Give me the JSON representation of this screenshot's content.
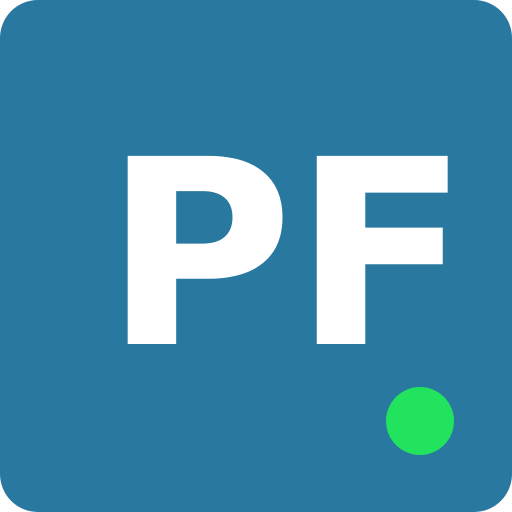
{
  "logo": {
    "monogram": "PF",
    "tile_color": "#2878a0",
    "text_color": "#ffffff",
    "status_indicator": {
      "state": "online",
      "color": "#21e35d"
    }
  }
}
